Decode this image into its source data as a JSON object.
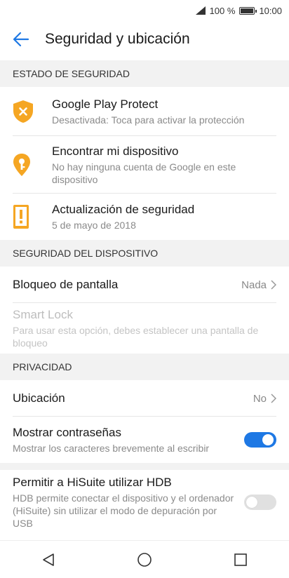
{
  "status_bar": {
    "battery_percent": "100 %",
    "time": "10:00"
  },
  "app_bar": {
    "title": "Seguridad y ubicación"
  },
  "sections": {
    "security_status": {
      "header": "ESTADO DE SEGURIDAD",
      "items": [
        {
          "title": "Google Play Protect",
          "subtitle": "Desactivada: Toca para activar la protección",
          "icon": "shield-x-icon"
        },
        {
          "title": "Encontrar mi dispositivo",
          "subtitle": "No hay ninguna cuenta de Google en este dispositivo",
          "icon": "location-key-icon"
        },
        {
          "title": "Actualización de seguridad",
          "subtitle": "5 de mayo de 2018",
          "icon": "phone-alert-icon"
        }
      ]
    },
    "device_security": {
      "header": "SEGURIDAD DEL DISPOSITIVO",
      "screen_lock": {
        "title": "Bloqueo de pantalla",
        "value": "Nada"
      },
      "smart_lock": {
        "title": "Smart Lock",
        "subtitle": "Para usar esta opción, debes establecer una pantalla de bloqueo"
      }
    },
    "privacy": {
      "header": "PRIVACIDAD",
      "location": {
        "title": "Ubicación",
        "value": "No"
      },
      "show_passwords": {
        "title": "Mostrar contraseñas",
        "subtitle": "Mostrar los caracteres brevemente al escribir",
        "enabled": true
      }
    },
    "hisuite": {
      "title": "Permitir a HiSuite utilizar HDB",
      "subtitle": "HDB permite conectar el dispositivo y el ordenador (HiSuite) sin utilizar el modo de depuración por USB",
      "enabled": false
    }
  },
  "colors": {
    "accent": "#1e78e4",
    "warning": "#f5a623",
    "section_bg": "#f2f2f2"
  }
}
